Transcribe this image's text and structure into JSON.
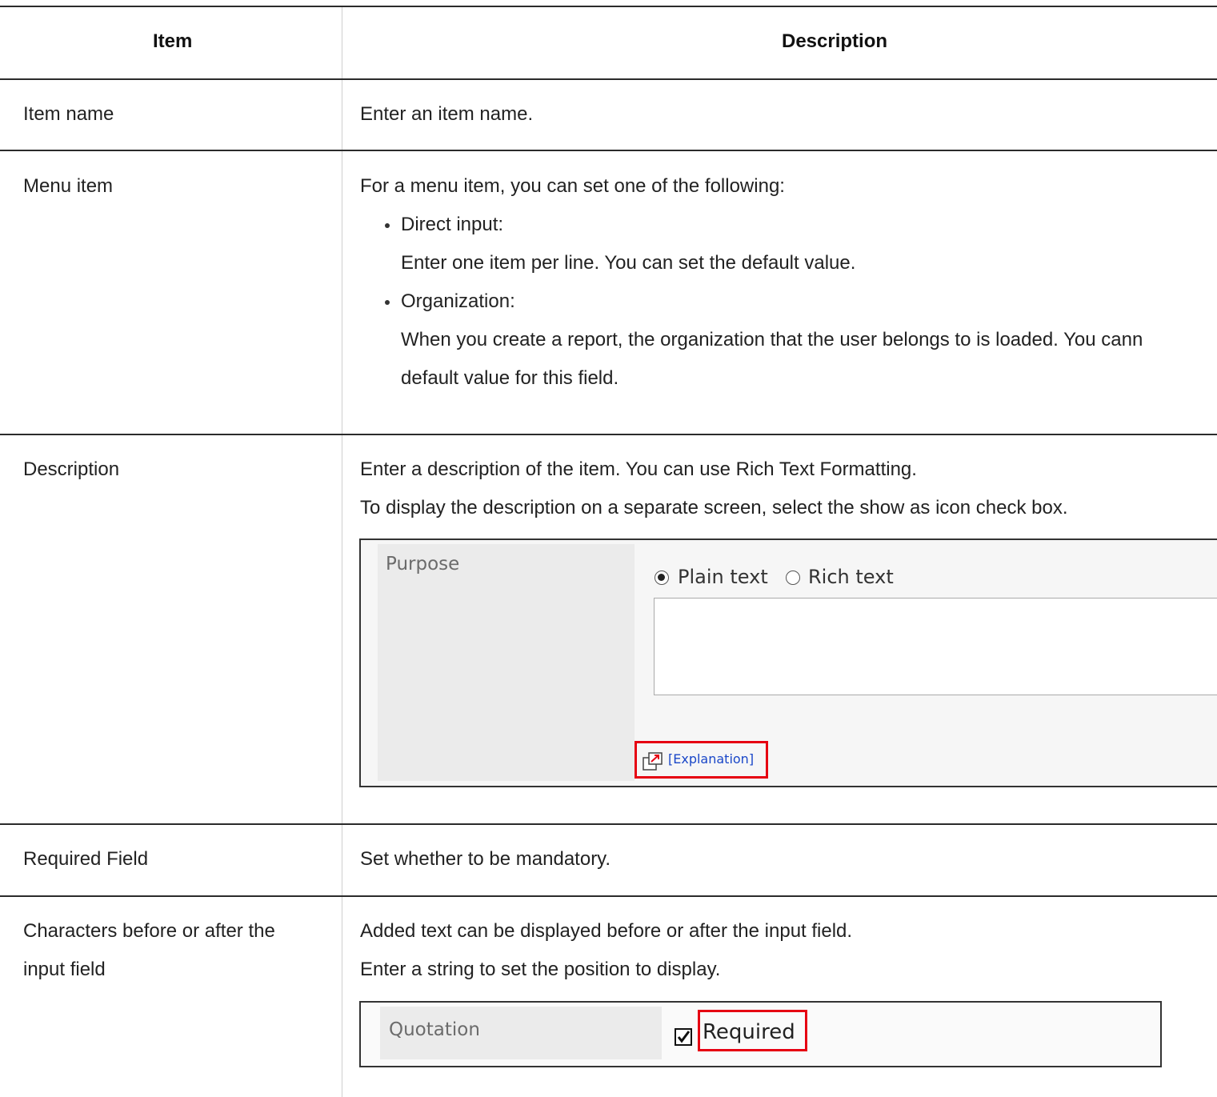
{
  "header": {
    "item": "Item",
    "description": "Description"
  },
  "rows": {
    "item_name": {
      "item": "Item name",
      "desc": "Enter an item name."
    },
    "menu_item": {
      "item": "Menu item",
      "desc": "For a menu item, you can set one of the following:",
      "bullet1": "Direct input:",
      "bullet1_text": "Enter one item per line. You can set the default value.",
      "bullet2": "Organization:",
      "bullet2_text_1": "When you create a report, the organization that the user belongs to is loaded. You cann",
      "bullet2_text_2": "default value for this field."
    },
    "description": {
      "item": "Description",
      "desc1": "Enter a description of the item. You can use Rich Text Formatting.",
      "desc2": "To display the description on a separate screen, select the show as icon check box.",
      "example": {
        "label": "Purpose",
        "radio_plain": "Plain text",
        "radio_rich": "Rich text",
        "selected": "Plain text",
        "link": "[Explanation]"
      }
    },
    "required": {
      "item": "Required Field",
      "desc": "Set whether to be mandatory."
    },
    "chars": {
      "item_line1": "Characters before or after the",
      "item_line2": "input field",
      "desc1": "Added text can be displayed before or after the input field.",
      "desc2": "Enter a string to set the position to display.",
      "example": {
        "label": "Quotation",
        "checkbox_label": "Required",
        "checked": true
      }
    }
  },
  "colors": {
    "highlight": "#e60012",
    "link": "#1a47c8"
  }
}
